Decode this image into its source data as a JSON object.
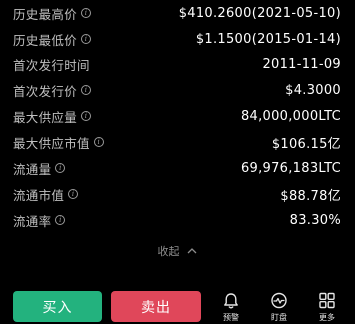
{
  "stats": [
    {
      "label": "历史最高价",
      "info": true,
      "value": "$410.2600(2021-05-10)"
    },
    {
      "label": "历史最低价",
      "info": true,
      "value": "$1.1500(2015-01-14)"
    },
    {
      "label": "首次发行时间",
      "info": false,
      "value": "2011-11-09"
    },
    {
      "label": "首次发行价",
      "info": true,
      "value": "$4.3000"
    },
    {
      "label": "最大供应量",
      "info": true,
      "value": "84,000,000LTC"
    },
    {
      "label": "最大供应市值",
      "info": true,
      "value": "$106.15亿"
    },
    {
      "label": "流通量",
      "info": true,
      "value": "69,976,183LTC"
    },
    {
      "label": "流通市值",
      "info": true,
      "value": "$88.78亿"
    },
    {
      "label": "流通率",
      "info": true,
      "value": "83.30%"
    }
  ],
  "collapse_label": "收起",
  "buy_label": "买入",
  "sell_label": "卖出",
  "tools": [
    {
      "label": "预警",
      "icon": "bell-icon"
    },
    {
      "label": "盯盘",
      "icon": "pulse-monitor-icon"
    },
    {
      "label": "更多",
      "icon": "grid-more-icon"
    }
  ],
  "colors": {
    "buy": "#23b27e",
    "sell": "#e0475a",
    "background": "#000000"
  }
}
